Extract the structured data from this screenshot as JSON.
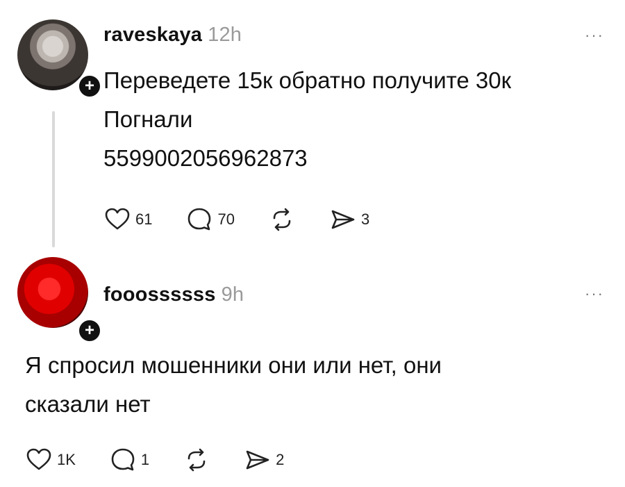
{
  "posts": [
    {
      "username": "raveskaya",
      "time": "12h",
      "text_lines": [
        "Переведете 15к обратно получите 30к",
        "Погнали",
        "5599002056962873"
      ],
      "likes": "61",
      "comments": "70",
      "shares": "3",
      "more": "···"
    },
    {
      "username": "fooossssss",
      "time": "9h",
      "text_lines": [
        "Я спросил мошенники они или нет, они",
        "сказали нет"
      ],
      "likes": "1K",
      "comments": "1",
      "shares": "2",
      "more": "···"
    }
  ],
  "follow_badge": "+",
  "colors": {
    "avatar2_red": "#e00000",
    "muted": "#9a9a9a"
  }
}
